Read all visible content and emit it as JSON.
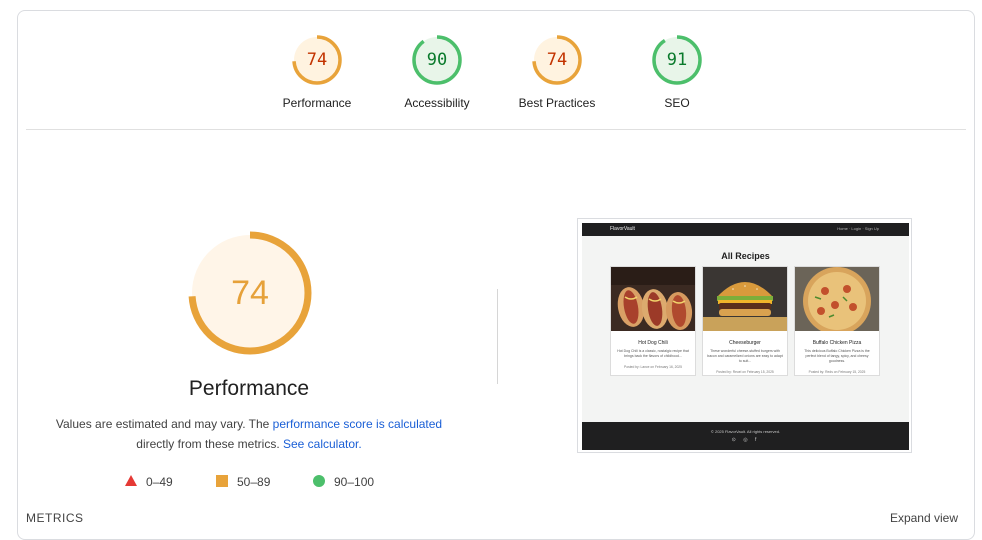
{
  "scores": [
    {
      "label": "Performance",
      "value": 74,
      "fraction": 0.74,
      "color": "#e8a33a",
      "bg": "#fff3e0",
      "textcolor": "#c33300"
    },
    {
      "label": "Accessibility",
      "value": 90,
      "fraction": 0.9,
      "color": "#4cbf6b",
      "bg": "#e8f5e9",
      "textcolor": "#0a7a2c"
    },
    {
      "label": "Best Practices",
      "value": 74,
      "fraction": 0.74,
      "color": "#e8a33a",
      "bg": "#fff3e0",
      "textcolor": "#c33300"
    },
    {
      "label": "SEO",
      "value": 91,
      "fraction": 0.91,
      "color": "#4cbf6b",
      "bg": "#e8f5e9",
      "textcolor": "#0a7a2c"
    }
  ],
  "main": {
    "score": 74,
    "fraction": 0.74,
    "title": "Performance",
    "note_part1": "Values are estimated and may vary. The ",
    "link1": "performance score is calculated",
    "note_part2": " directly from these metrics. ",
    "link2": "See calculator."
  },
  "legend": [
    {
      "range": "0–49",
      "shape": "triangle",
      "color": "#e53935"
    },
    {
      "range": "50–89",
      "shape": "square",
      "color": "#e8a33a"
    },
    {
      "range": "90–100",
      "shape": "circle",
      "color": "#4cbf6b"
    }
  ],
  "screenshot": {
    "brand": "FlavorVault",
    "nav": "Home  ·  Login  ·  Sign Up",
    "heading": "All Recipes",
    "cards": [
      {
        "title": "Hot Dog Chili",
        "desc": "Hot Dog Chili is a classic, nostalgic recipe that brings back the flavors of childhood...",
        "posted": "Posted by: Lance on February 16, 2025"
      },
      {
        "title": "Cheeseburger",
        "desc": "These wonderful cheese-stuffed burgers with bacon and caramelized onions are easy to adapt to suit...",
        "posted": "Posted by: Reuel on February 15, 2025"
      },
      {
        "title": "Buffalo Chicken Pizza",
        "desc": "This delicious Buffalo Chicken Pizza is the perfect blend of tangy, spicy, and cheesy goodness.",
        "posted": "Posted by: Reds on February 15, 2025"
      }
    ],
    "footer": "© 2025 FlavorVault. All rights reserved.",
    "footer_icons": "⊙ ◎ f"
  },
  "metrics_label": "METRICS",
  "expand_label": "Expand view"
}
